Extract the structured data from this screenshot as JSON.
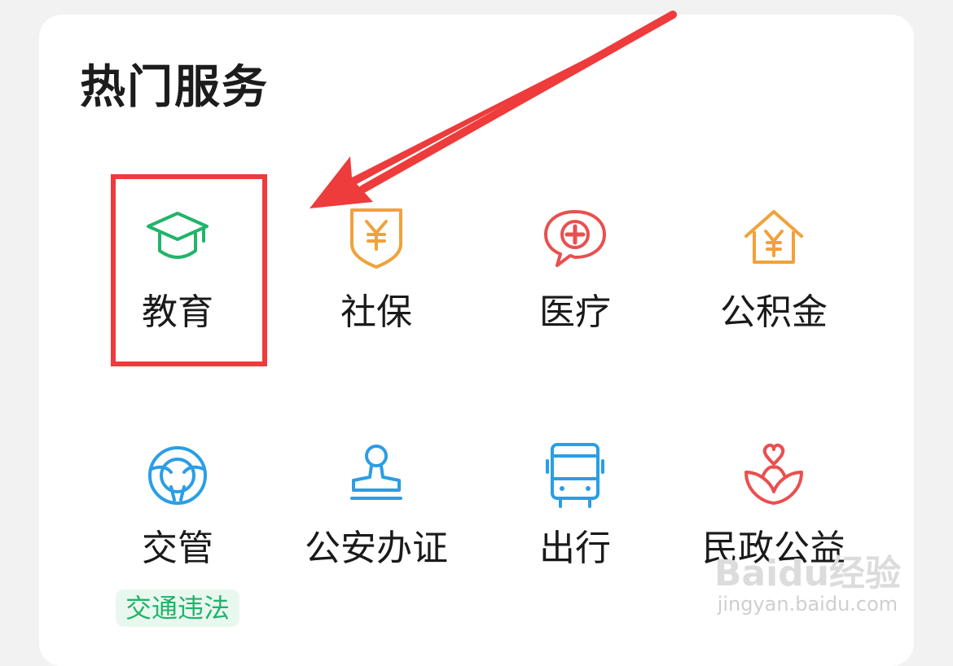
{
  "section": {
    "title": "热门服务"
  },
  "services": [
    {
      "label": "教育",
      "icon": "graduation-cap-icon",
      "color": "#22b46a"
    },
    {
      "label": "社保",
      "icon": "shield-yen-icon",
      "color": "#f0a23a"
    },
    {
      "label": "医疗",
      "icon": "medical-chat-icon",
      "color": "#ea4f4f"
    },
    {
      "label": "公积金",
      "icon": "house-yen-icon",
      "color": "#f0a23a"
    },
    {
      "label": "交管",
      "icon": "steering-wheel-icon",
      "color": "#2a9ee6",
      "tag": "交通违法"
    },
    {
      "label": "公安办证",
      "icon": "stamp-icon",
      "color": "#2a9ee6"
    },
    {
      "label": "出行",
      "icon": "bus-icon",
      "color": "#2a9ee6"
    },
    {
      "label": "民政公益",
      "icon": "heart-flower-icon",
      "color": "#ea4f4f"
    }
  ],
  "annotation": {
    "highlight_color": "#ee3b3b"
  },
  "watermark": {
    "main": "Baidu经验",
    "sub": "jingyan.baidu.com"
  }
}
